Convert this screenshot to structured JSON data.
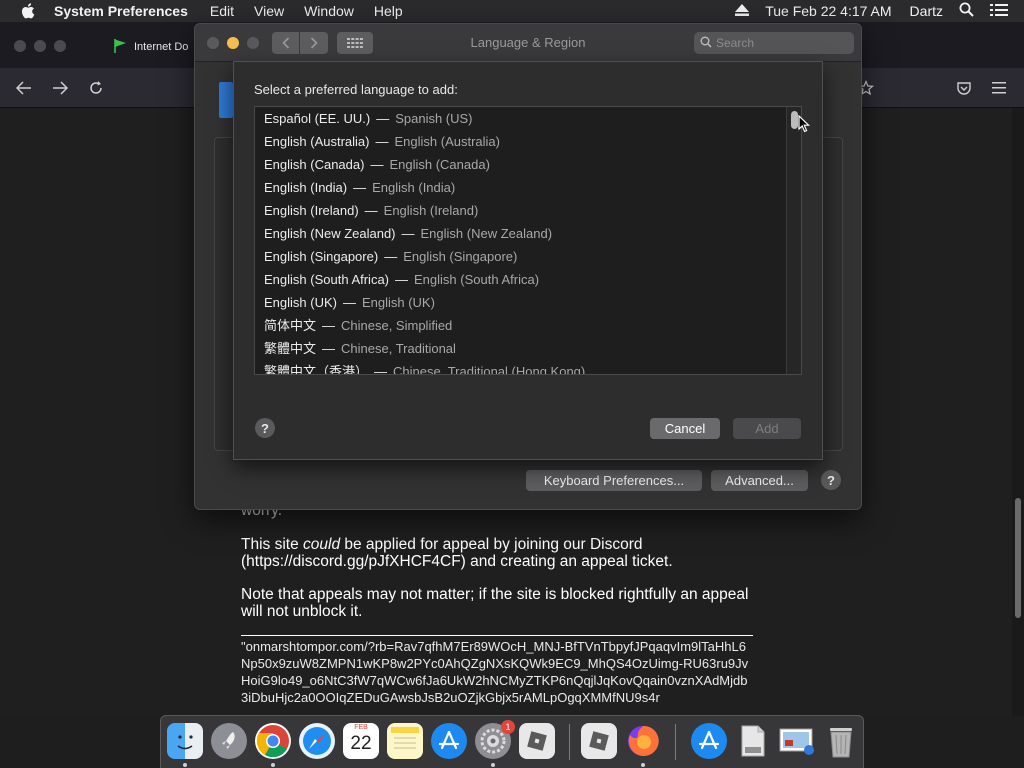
{
  "menubar": {
    "app_name": "System Preferences",
    "items": [
      "Edit",
      "View",
      "Window",
      "Help"
    ],
    "clock": "Tue Feb 22  4:17 AM",
    "user": "Dartz"
  },
  "browser": {
    "tab_title": "Internet Do"
  },
  "page": {
    "p1": "worry.",
    "p2_before": "This site ",
    "p2_em": "could",
    "p2_after": " be applied for appeal by joining our Discord (https://discord.gg/pJfXHCF4CF) and creating an appeal ticket.",
    "p3": "Note that appeals may not matter; if the site is blocked rightfully an appeal will not unblock it.",
    "url": "\"onmarshtompor.com/?rb=Rav7qfhM7Er89WOcH_MNJ-BfTVnTbpyfJPqaqvIm9lTaHhL6Np50x9zuW8ZMPN1wKP8w2PYc0AhQZgNXsKQWk9EC9_MhQS4OzUimg-RU63ru9JvHoiG9lo49_o6NtC3fW7qWCw6fJa6UkW2hNCMyZTKP6nQqjlJqKovQqain0vznXAdMjdb3iDbuHjc2a0OOIqZEDuGAwsbJsB2uOZjkGbjx5rAMLpOgqXMMfNU9s4r"
  },
  "window": {
    "title": "Language & Region",
    "search_placeholder": "Search",
    "keyboard_prefs_label": "Keyboard Preferences...",
    "advanced_label": "Advanced..."
  },
  "sheet": {
    "prompt": "Select a preferred language to add:",
    "languages": [
      {
        "native": "Español (EE. UU.)",
        "english": "Spanish (US)"
      },
      {
        "native": "English (Australia)",
        "english": "English (Australia)"
      },
      {
        "native": "English (Canada)",
        "english": "English (Canada)"
      },
      {
        "native": "English (India)",
        "english": "English (India)"
      },
      {
        "native": "English (Ireland)",
        "english": "English (Ireland)"
      },
      {
        "native": "English (New Zealand)",
        "english": "English (New Zealand)"
      },
      {
        "native": "English (Singapore)",
        "english": "English (Singapore)"
      },
      {
        "native": "English (South Africa)",
        "english": "English (South Africa)"
      },
      {
        "native": "English (UK)",
        "english": "English (UK)"
      },
      {
        "native": "简体中文",
        "english": "Chinese, Simplified"
      },
      {
        "native": "繁體中文",
        "english": "Chinese, Traditional"
      },
      {
        "native": "繁體中文（香港）",
        "english": "Chinese, Traditional (Hong Kong)"
      }
    ],
    "separator": "—",
    "help_label": "?",
    "cancel_label": "Cancel",
    "add_label": "Add"
  },
  "dock": {
    "calendar_month": "FEB",
    "calendar_day": "22",
    "settings_badge": "1"
  },
  "colors": {
    "accent": "#2f7ad6",
    "minimize": "#f5bf4f",
    "badge": "#e5443b"
  }
}
